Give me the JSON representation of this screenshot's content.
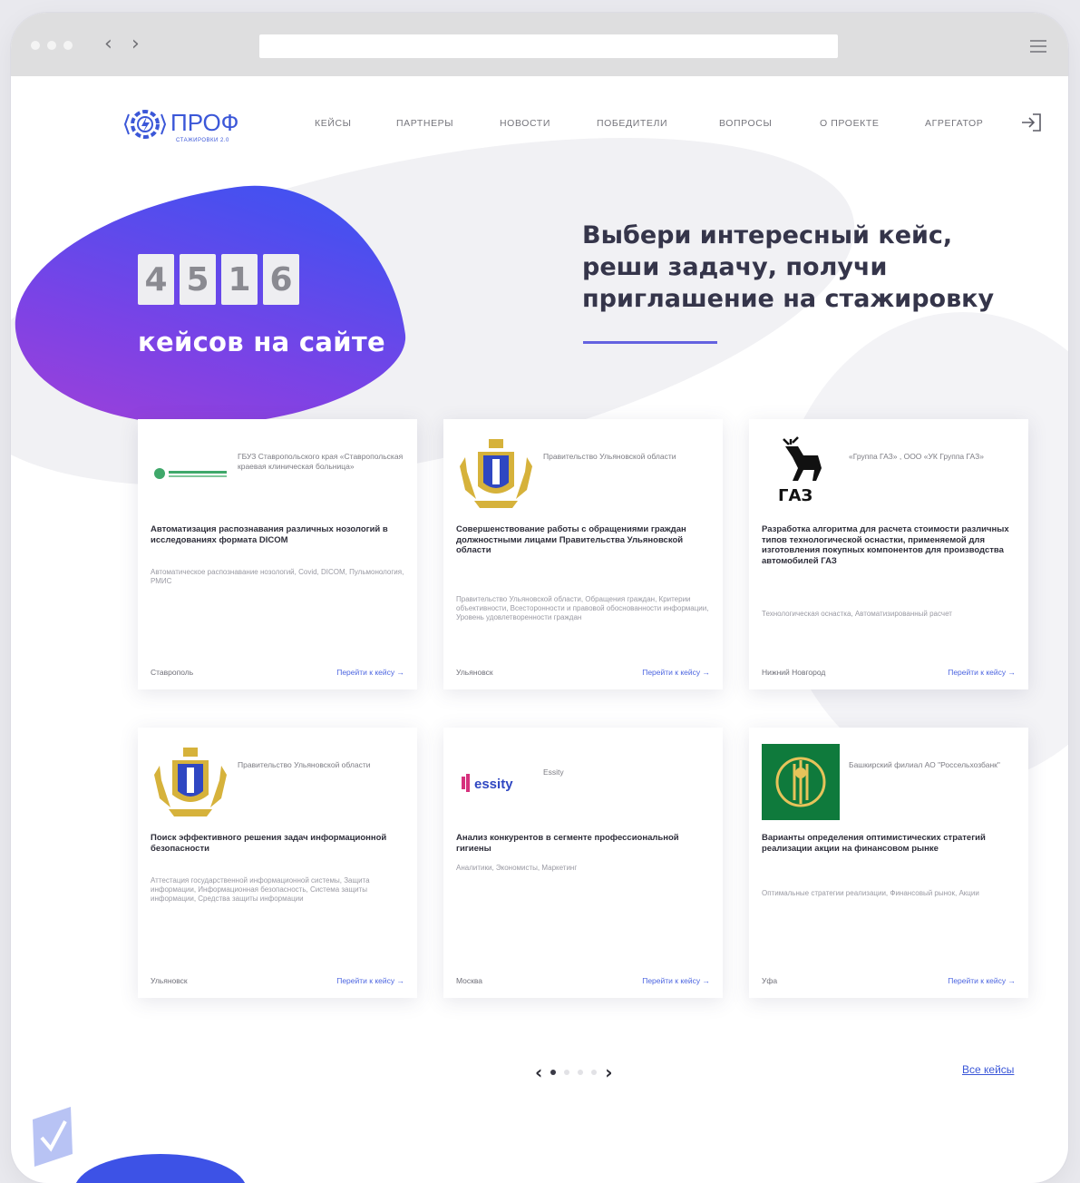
{
  "browser": {
    "back_arrow": "‹",
    "forward_arrow": "›",
    "menu_icon": "hamburger-icon"
  },
  "logo": {
    "name": "ПРОФ",
    "subtitle": "СТАЖИРОВКИ 2.0"
  },
  "nav": {
    "items": [
      "кейсы",
      "партнеры",
      "новости",
      "победители",
      "вопросы",
      "о проекте",
      "агрегатор"
    ],
    "login_icon": "login-icon"
  },
  "hero": {
    "counter_digits": [
      "4",
      "5",
      "1",
      "6"
    ],
    "counter_label": "кейсов на сайте",
    "headline": "Выбери интересный кейс, реши задачу, получи приглашение на стажировку",
    "accent_color": "#6462e0"
  },
  "cards": [
    {
      "org": "ГБУЗ Ставропольского края «Ставропольская краевая клиническая больница»",
      "logo": "medical-logo",
      "title": "Автоматизация распознавания различных нозологий в исследованиях формата DICOM",
      "tags": "Автоматическое распознавание нозологий, Covid, DICOM, Пульмонология, РМИС",
      "city": "Ставрополь",
      "link": "Перейти к кейсу  →"
    },
    {
      "org": "Правительство Ульяновской области",
      "logo": "coat-of-arms-logo",
      "title": "Совершенствование работы с обращениями граждан должностными лицами Правительства Ульяновской области",
      "tags": "Правительство Ульяновской области, Обращения граждан, Критерии объективности, Всесторонности и правовой обоснованности информации, Уровень удовлетворенности граждан",
      "city": "Ульяновск",
      "link": "Перейти к кейсу  →"
    },
    {
      "org": "«Группа ГАЗ» , ООО «УК Группа ГАЗ»",
      "logo": "gaz-deer-logo",
      "logo_text": "ГАЗ",
      "title": "Разработка алгоритма для расчета стоимости различных типов технологической оснастки, применяемой для изготовления покупных компонентов для производства автомобилей ГАЗ",
      "tags": "Технологическая оснастка, Автоматизированный расчет",
      "city": "Нижний Новгород",
      "link": "Перейти к кейсу  →"
    },
    {
      "org": "Правительство Ульяновской области",
      "logo": "coat-of-arms-logo",
      "title": "Поиск эффективного решения задач информационной безопасности",
      "tags": "Аттестация государственной информационной системы, Защита информации, Информационная безопасность, Система защиты информации, Средства защиты информации",
      "city": "Ульяновск",
      "link": "Перейти к кейсу  →"
    },
    {
      "org": "Essity",
      "logo": "essity-logo",
      "logo_text": "essity",
      "title": "Анализ конкурентов в сегменте профессиональной гигиены",
      "tags": "Аналитики, Экономисты, Маркетинг",
      "city": "Москва",
      "link": "Перейти к кейсу  →"
    },
    {
      "org": "Башкирский филиал АО \"Россельхозбанк\"",
      "logo": "rosselkhozbank-logo",
      "title": "Варианты определения оптимистических стратегий реализации акции на финансовом рынке",
      "tags": "Оптимальные стратегии реализации, Финансовый рынок, Акции",
      "city": "Уфа",
      "link": "Перейти к кейсу  →"
    }
  ],
  "pager": {
    "prev": "‹",
    "next": "›",
    "active_page": 1,
    "page_count": 4
  },
  "all_cases_link": "Все кейсы"
}
